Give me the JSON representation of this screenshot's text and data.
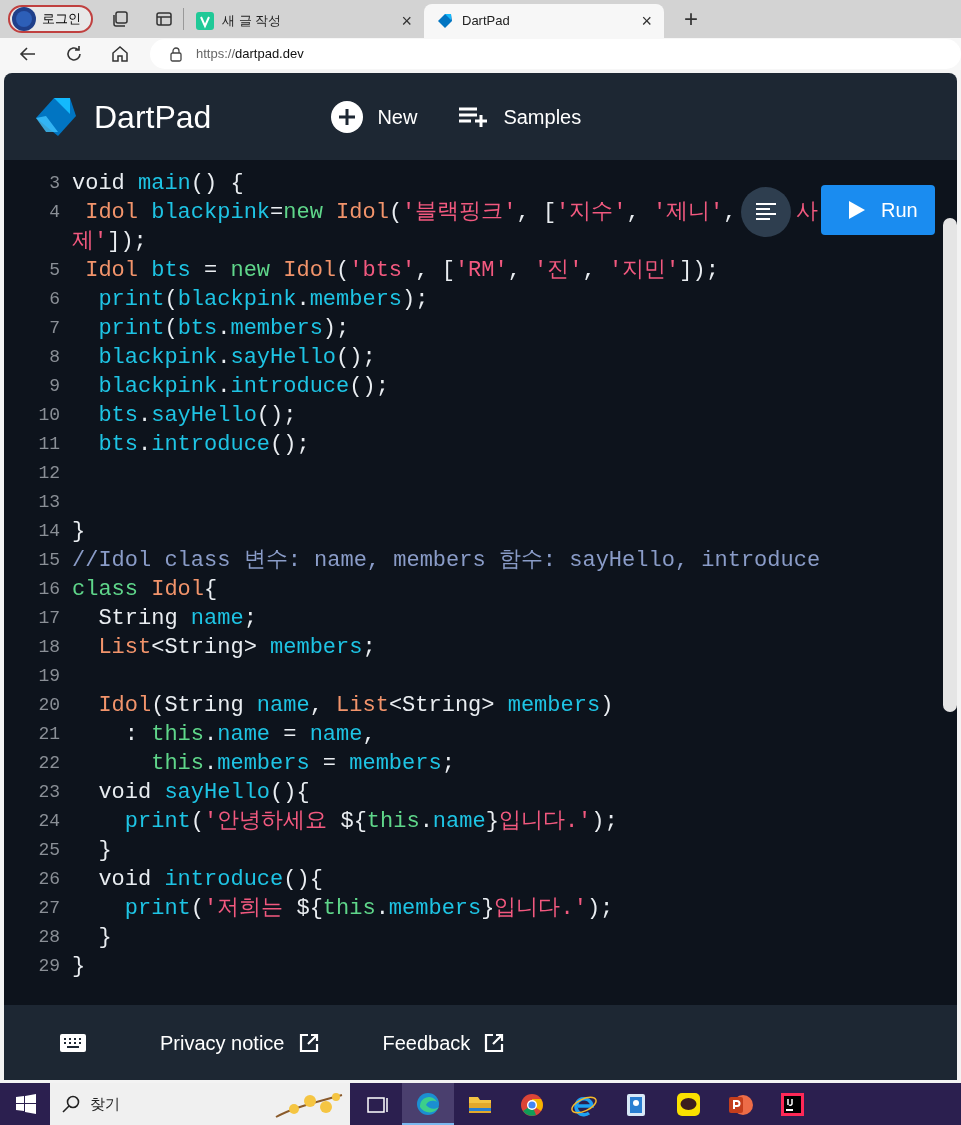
{
  "browser": {
    "profile": "로그인",
    "tabs": [
      {
        "title": "새 글 작성",
        "selected": false,
        "close": "×"
      },
      {
        "title": "DartPad",
        "selected": true,
        "close": "×"
      }
    ],
    "new_tab": "+",
    "url_scheme": "https://",
    "url_host": "dartpad.dev"
  },
  "app": {
    "title": "DartPad",
    "actions": [
      "New",
      "Samples"
    ],
    "run": "Run"
  },
  "code": [
    {
      "number": "3",
      "tokens": [
        {
          "kind": "plain",
          "text": "void "
        },
        {
          "kind": "ident",
          "text": "main"
        },
        {
          "kind": "plain",
          "text": "() {"
        }
      ]
    },
    {
      "number": "4",
      "tokens": [
        {
          "kind": "type",
          "text": " Idol"
        },
        {
          "kind": "ident",
          "text": " blackpink"
        },
        {
          "kind": "plain",
          "text": "="
        },
        {
          "kind": "keyword",
          "text": "new"
        },
        {
          "kind": "type",
          "text": " Idol"
        },
        {
          "kind": "plain",
          "text": "("
        },
        {
          "kind": "string",
          "text": "'블랙핑크'"
        },
        {
          "kind": "plain",
          "text": ", ["
        },
        {
          "kind": "string",
          "text": "'지수'"
        },
        {
          "kind": "plain",
          "text": ", "
        },
        {
          "kind": "string",
          "text": "'제니'"
        },
        {
          "kind": "plain",
          "text": ","
        }
      ],
      "after_cover": [
        {
          "kind": "string",
          "text": "사"
        }
      ],
      "wrap": [
        {
          "kind": "string",
          "text": "제'"
        },
        {
          "kind": "plain",
          "text": "]);"
        }
      ]
    },
    {
      "number": "5",
      "tokens": [
        {
          "kind": "type",
          "text": " Idol"
        },
        {
          "kind": "ident",
          "text": " bts"
        },
        {
          "kind": "plain",
          "text": " = "
        },
        {
          "kind": "keyword",
          "text": "new"
        },
        {
          "kind": "type",
          "text": " Idol"
        },
        {
          "kind": "plain",
          "text": "("
        },
        {
          "kind": "string",
          "text": "'bts'"
        },
        {
          "kind": "plain",
          "text": ", ["
        },
        {
          "kind": "string",
          "text": "'RM'"
        },
        {
          "kind": "plain",
          "text": ", "
        },
        {
          "kind": "string",
          "text": "'진'"
        },
        {
          "kind": "plain",
          "text": ", "
        },
        {
          "kind": "string",
          "text": "'지민'"
        },
        {
          "kind": "plain",
          "text": "]);"
        }
      ]
    },
    {
      "number": "6",
      "tokens": [
        {
          "kind": "ident",
          "text": "  print"
        },
        {
          "kind": "plain",
          "text": "("
        },
        {
          "kind": "ident",
          "text": "blackpink"
        },
        {
          "kind": "plain",
          "text": "."
        },
        {
          "kind": "ident",
          "text": "members"
        },
        {
          "kind": "plain",
          "text": ");"
        }
      ]
    },
    {
      "number": "7",
      "tokens": [
        {
          "kind": "ident",
          "text": "  print"
        },
        {
          "kind": "plain",
          "text": "("
        },
        {
          "kind": "ident",
          "text": "bts"
        },
        {
          "kind": "plain",
          "text": "."
        },
        {
          "kind": "ident",
          "text": "members"
        },
        {
          "kind": "plain",
          "text": ");"
        }
      ]
    },
    {
      "number": "8",
      "tokens": [
        {
          "kind": "ident",
          "text": "  blackpink"
        },
        {
          "kind": "plain",
          "text": "."
        },
        {
          "kind": "ident",
          "text": "sayHello"
        },
        {
          "kind": "plain",
          "text": "();"
        }
      ]
    },
    {
      "number": "9",
      "tokens": [
        {
          "kind": "ident",
          "text": "  blackpink"
        },
        {
          "kind": "plain",
          "text": "."
        },
        {
          "kind": "ident",
          "text": "introduce"
        },
        {
          "kind": "plain",
          "text": "();"
        }
      ]
    },
    {
      "number": "10",
      "tokens": [
        {
          "kind": "ident",
          "text": "  bts"
        },
        {
          "kind": "plain",
          "text": "."
        },
        {
          "kind": "ident",
          "text": "sayHello"
        },
        {
          "kind": "plain",
          "text": "();"
        }
      ]
    },
    {
      "number": "11",
      "tokens": [
        {
          "kind": "ident",
          "text": "  bts"
        },
        {
          "kind": "plain",
          "text": "."
        },
        {
          "kind": "ident",
          "text": "introduce"
        },
        {
          "kind": "plain",
          "text": "();"
        }
      ]
    },
    {
      "number": "12"
    },
    {
      "number": "13"
    },
    {
      "number": "14",
      "tokens": [
        {
          "kind": "plain",
          "text": "}"
        }
      ]
    },
    {
      "number": "15",
      "tokens": [
        {
          "kind": "comment",
          "text": "//Idol class 변수: name, members 함수: sayHello, introduce"
        }
      ]
    },
    {
      "number": "16",
      "tokens": [
        {
          "kind": "keyword",
          "text": "class"
        },
        {
          "kind": "type",
          "text": " Idol"
        },
        {
          "kind": "plain",
          "text": "{"
        }
      ]
    },
    {
      "number": "17",
      "tokens": [
        {
          "kind": "plain",
          "text": "  String "
        },
        {
          "kind": "ident",
          "text": "name"
        },
        {
          "kind": "plain",
          "text": ";"
        }
      ]
    },
    {
      "number": "18",
      "tokens": [
        {
          "kind": "type",
          "text": "  List"
        },
        {
          "kind": "plain",
          "text": "<String> "
        },
        {
          "kind": "ident",
          "text": "members"
        },
        {
          "kind": "plain",
          "text": ";"
        }
      ]
    },
    {
      "number": "19"
    },
    {
      "number": "20",
      "tokens": [
        {
          "kind": "type",
          "text": "  Idol"
        },
        {
          "kind": "plain",
          "text": "(String "
        },
        {
          "kind": "ident",
          "text": "name"
        },
        {
          "kind": "plain",
          "text": ", "
        },
        {
          "kind": "type",
          "text": "List"
        },
        {
          "kind": "plain",
          "text": "<String> "
        },
        {
          "kind": "ident",
          "text": "members"
        },
        {
          "kind": "plain",
          "text": ")"
        }
      ]
    },
    {
      "number": "21",
      "tokens": [
        {
          "kind": "plain",
          "text": "    : "
        },
        {
          "kind": "keyword",
          "text": "this"
        },
        {
          "kind": "plain",
          "text": "."
        },
        {
          "kind": "ident",
          "text": "name"
        },
        {
          "kind": "plain",
          "text": " = "
        },
        {
          "kind": "ident",
          "text": "name"
        },
        {
          "kind": "plain",
          "text": ","
        }
      ]
    },
    {
      "number": "22",
      "tokens": [
        {
          "kind": "keyword",
          "text": "      this"
        },
        {
          "kind": "plain",
          "text": "."
        },
        {
          "kind": "ident",
          "text": "members"
        },
        {
          "kind": "plain",
          "text": " = "
        },
        {
          "kind": "ident",
          "text": "members"
        },
        {
          "kind": "plain",
          "text": ";"
        }
      ]
    },
    {
      "number": "23",
      "tokens": [
        {
          "kind": "plain",
          "text": "  void "
        },
        {
          "kind": "ident",
          "text": "sayHello"
        },
        {
          "kind": "plain",
          "text": "(){"
        }
      ]
    },
    {
      "number": "24",
      "tokens": [
        {
          "kind": "ident",
          "text": "    print"
        },
        {
          "kind": "plain",
          "text": "("
        },
        {
          "kind": "string",
          "text": "'안녕하세요 "
        },
        {
          "kind": "plain",
          "text": "${"
        },
        {
          "kind": "keyword",
          "text": "this"
        },
        {
          "kind": "plain",
          "text": "."
        },
        {
          "kind": "ident",
          "text": "name"
        },
        {
          "kind": "plain",
          "text": "}"
        },
        {
          "kind": "string",
          "text": "입니다.'"
        },
        {
          "kind": "plain",
          "text": ");"
        }
      ]
    },
    {
      "number": "25",
      "tokens": [
        {
          "kind": "plain",
          "text": "  }"
        }
      ]
    },
    {
      "number": "26",
      "tokens": [
        {
          "kind": "plain",
          "text": "  void "
        },
        {
          "kind": "ident",
          "text": "introduce"
        },
        {
          "kind": "plain",
          "text": "(){"
        }
      ]
    },
    {
      "number": "27",
      "tokens": [
        {
          "kind": "ident",
          "text": "    print"
        },
        {
          "kind": "plain",
          "text": "("
        },
        {
          "kind": "string",
          "text": "'저희는 "
        },
        {
          "kind": "plain",
          "text": "${"
        },
        {
          "kind": "keyword",
          "text": "this"
        },
        {
          "kind": "plain",
          "text": "."
        },
        {
          "kind": "ident",
          "text": "members"
        },
        {
          "kind": "plain",
          "text": "}"
        },
        {
          "kind": "string",
          "text": "입니다.'"
        },
        {
          "kind": "plain",
          "text": ");"
        }
      ]
    },
    {
      "number": "28",
      "tokens": [
        {
          "kind": "plain",
          "text": "  }"
        }
      ]
    },
    {
      "number": "29",
      "tokens": [
        {
          "kind": "plain",
          "text": "}"
        }
      ]
    }
  ],
  "footer": {
    "links": [
      "Privacy notice",
      "Feedback"
    ]
  },
  "taskbar": {
    "search": "찾기"
  }
}
